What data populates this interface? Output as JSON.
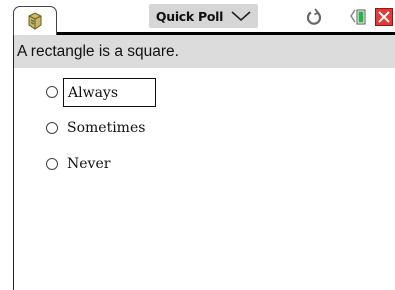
{
  "toolbar": {
    "title": "Quick Poll",
    "title_dropdown_icon": "chevron-down-icon",
    "doc_tab_icon": "document-box-icon",
    "refresh_icon": "refresh-icon",
    "battery_icon": "battery-icon",
    "close_icon": "close-icon"
  },
  "colors": {
    "question_bg": "#dcdcdc",
    "title_btn_bg": "#d6d6d6",
    "battery_green": "#2db24a",
    "close_red": "#e23a3a"
  },
  "poll": {
    "question": "A rectangle is a square.",
    "options": [
      {
        "label": "Always",
        "focused": true
      },
      {
        "label": "Sometimes",
        "focused": false
      },
      {
        "label": "Never",
        "focused": false
      }
    ]
  }
}
